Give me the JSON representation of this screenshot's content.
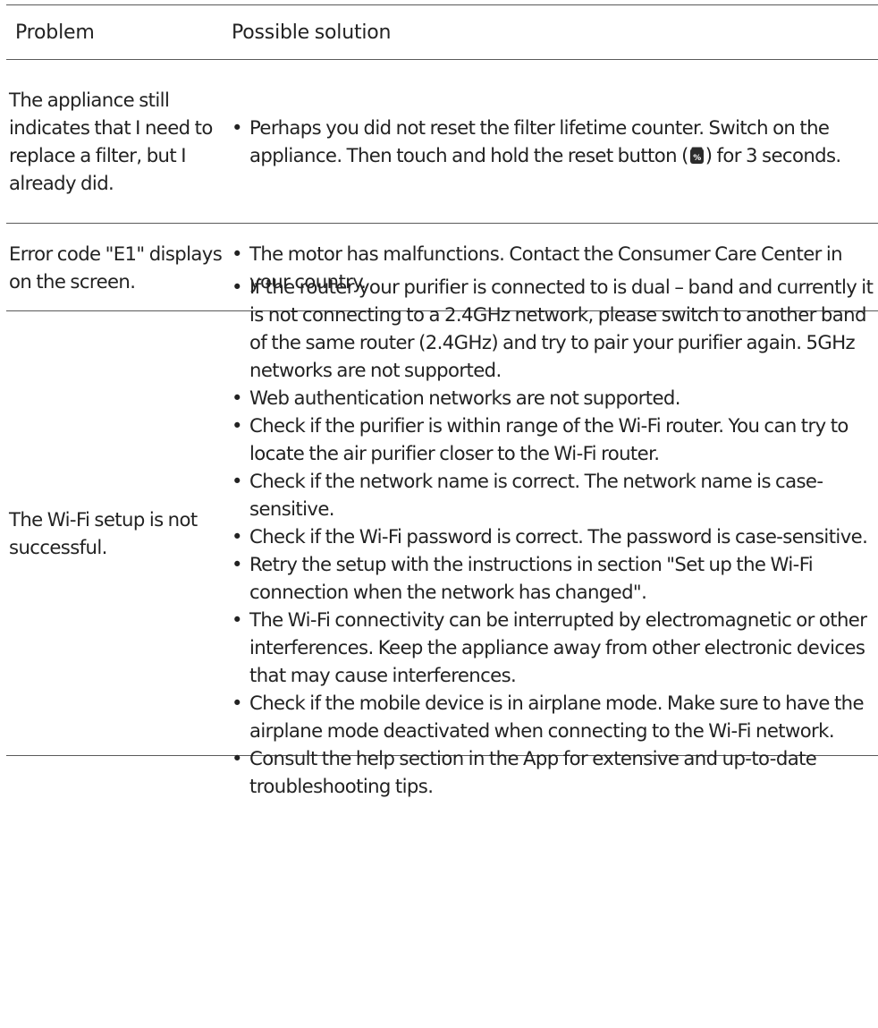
{
  "header": {
    "problem": "Problem",
    "solution": "Possible solution"
  },
  "rows": [
    {
      "problem": "The appliance still indicates that I need to replace a filter, but I already did.",
      "solutions": [
        {
          "before": "Perhaps you did not reset the filter lifetime counter. Switch on the appliance. Then touch and hold the reset button (",
          "icon": "filter-reset-icon",
          "after": ") for 3 seconds."
        }
      ]
    },
    {
      "problem": "Error code \"E1\" displays on the screen.",
      "solutions": [
        "The motor has malfunctions. Contact the Consumer Care Center in your country."
      ]
    },
    {
      "problem": "The Wi-Fi setup is not successful.",
      "solutions": [
        "If the router your purifier is connected to is dual – band and currently it is not connecting to a 2.4GHz network, please switch to another band of the same router (2.4GHz) and try to pair your purifier again. 5GHz networks are not supported.",
        "Web authentication networks are not supported.",
        "Check if the purifier is within range of the Wi-Fi router. You can try to locate the air purifier closer to the Wi-Fi router.",
        "Check if the network name is correct. The network name is case-sensitive.",
        "Check if the Wi-Fi password is correct. The password is case-sensitive.",
        "Retry the setup with the instructions in section \"Set up the Wi-Fi connection when the network has changed\".",
        "The Wi-Fi connectivity can be interrupted by electromagnetic or other interferences. Keep the appliance away from other electronic devices that may cause interferences.",
        "Check if the mobile device is in airplane mode. Make sure to have the airplane mode deactivated when connecting to the Wi-Fi network.",
        "Consult the help section in the App for extensive and up-to-date troubleshooting tips."
      ]
    }
  ]
}
